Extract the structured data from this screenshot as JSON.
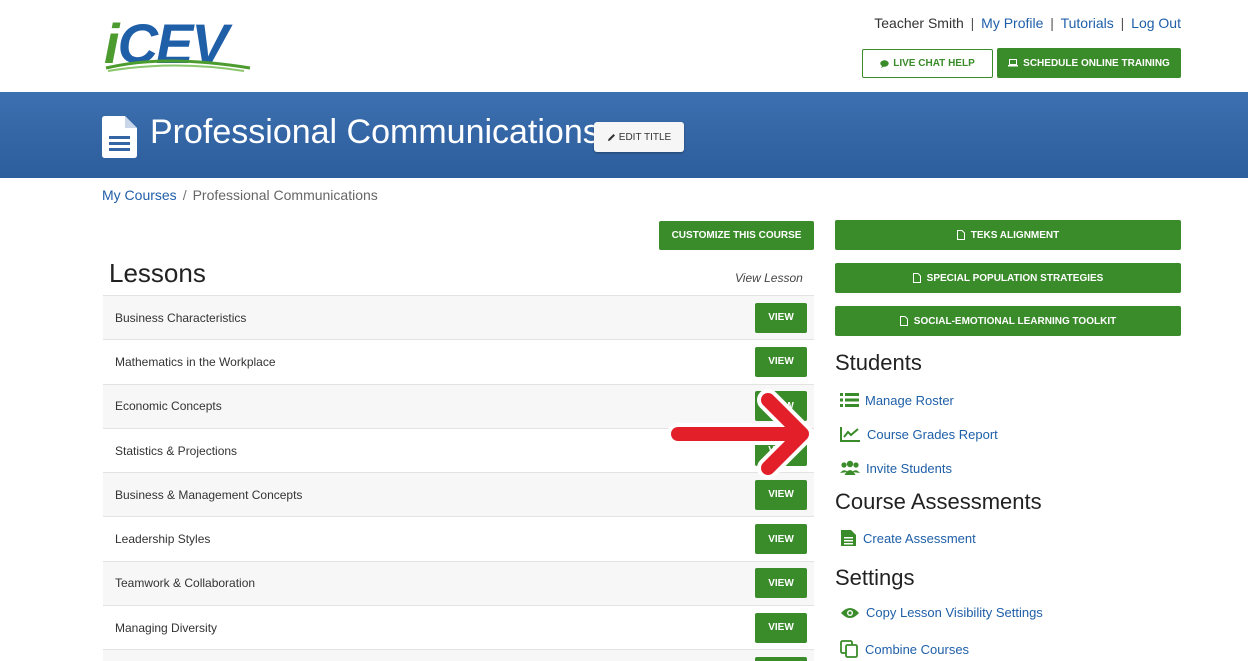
{
  "header": {
    "logo_text_i": "i",
    "logo_text_rest": "CEV",
    "user_name": "Teacher Smith",
    "links": [
      "My Profile",
      "Tutorials",
      "Log Out"
    ],
    "live_chat_label": "LIVE CHAT HELP",
    "schedule_label": "SCHEDULE ONLINE TRAINING"
  },
  "banner": {
    "title": "Professional Communications",
    "edit_label": "EDIT TITLE"
  },
  "breadcrumb": {
    "root": "My Courses",
    "current": "Professional Communications"
  },
  "lessons": {
    "customize_label": "CUSTOMIZE THIS COURSE",
    "title": "Lessons",
    "column_header": "View Lesson",
    "view_label": "VIEW",
    "items": [
      "Business Characteristics",
      "Mathematics in the Workplace",
      "Economic Concepts",
      "Statistics & Projections",
      "Business & Management Concepts",
      "Leadership Styles",
      "Teamwork & Collaboration",
      "Managing Diversity"
    ]
  },
  "sidebar": {
    "buttons": [
      "TEKS ALIGNMENT",
      "SPECIAL POPULATION STRATEGIES",
      "SOCIAL-EMOTIONAL LEARNING TOOLKIT"
    ],
    "students_title": "Students",
    "students_links": [
      "Manage Roster",
      "Course Grades Report",
      "Invite Students"
    ],
    "assessments_title": "Course Assessments",
    "assessments_links": [
      "Create Assessment"
    ],
    "settings_title": "Settings",
    "settings_links": [
      "Copy Lesson Visibility Settings",
      "Combine Courses"
    ]
  },
  "colors": {
    "brand_blue": "#1f5fa8",
    "brand_green": "#3a8b2a",
    "banner_blue": "#3466a6",
    "annotation_red": "#e3202a"
  },
  "icons": {
    "live_chat": "chat-bubble-icon",
    "schedule": "laptop-icon",
    "edit": "pencil-icon",
    "doc": "document-icon",
    "roster": "list-icon",
    "grades": "line-chart-icon",
    "invite": "users-icon",
    "assessment": "file-icon",
    "visibility": "eye-icon",
    "combine": "copy-icon"
  }
}
